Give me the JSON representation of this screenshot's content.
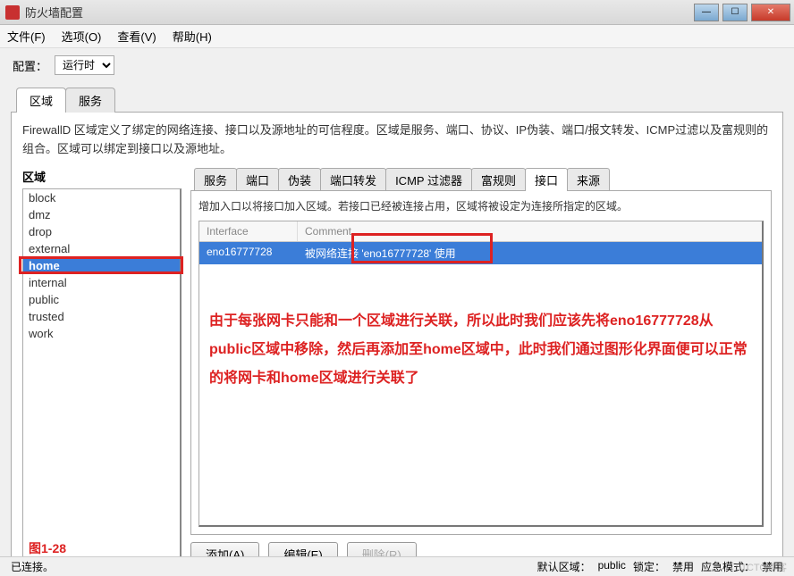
{
  "window": {
    "title": "防火墙配置"
  },
  "menu": {
    "file": "文件(F)",
    "options": "选项(O)",
    "view": "查看(V)",
    "help": "帮助(H)"
  },
  "config": {
    "label": "配置：",
    "value": "运行时"
  },
  "main_tabs": {
    "zone": "区域",
    "service": "服务"
  },
  "description": "FirewallD 区域定义了绑定的网络连接、接口以及源地址的可信程度。区域是服务、端口、协议、IP伪装、端口/报文转发、ICMP过滤以及富规则的组合。区域可以绑定到接口以及源地址。",
  "left": {
    "label": "区域",
    "items": {
      "block": "block",
      "dmz": "dmz",
      "drop": "drop",
      "external": "external",
      "home": "home",
      "internal": "internal",
      "public": "public",
      "trusted": "trusted",
      "work": "work"
    }
  },
  "sub_tabs": {
    "services": "服务",
    "ports": "端口",
    "masq": "伪装",
    "port_fwd": "端口转发",
    "icmp": "ICMP 过滤器",
    "rich": "富规则",
    "interfaces": "接口",
    "sources": "来源"
  },
  "iface_panel": {
    "desc": "增加入口以将接口加入区域。若接口已经被连接占用，区域将被设定为连接所指定的区域。",
    "head_interface": "Interface",
    "head_comment": "Comment",
    "row_interface": "eno16777728",
    "row_comment": "被网络连接 'eno16777728' 使用"
  },
  "overlay": "由于每张网卡只能和一个区域进行关联，所以此时我们应该先将eno16777728从public区域中移除，然后再添加至home区域中，此时我们通过图形化界面便可以正常的将网卡和home区域进行关联了",
  "buttons": {
    "add": "添加(A)",
    "edit": "编辑(E)",
    "remove": "删除(R)"
  },
  "figure": "图1-28",
  "status": {
    "left": "已连接。",
    "default_zone_label": "默认区域：",
    "default_zone": "public",
    "lock": "锁定：",
    "lock_val": "禁用",
    "panic": "应急模式：",
    "panic_val": "禁用"
  },
  "watermark": "51CTO博客"
}
